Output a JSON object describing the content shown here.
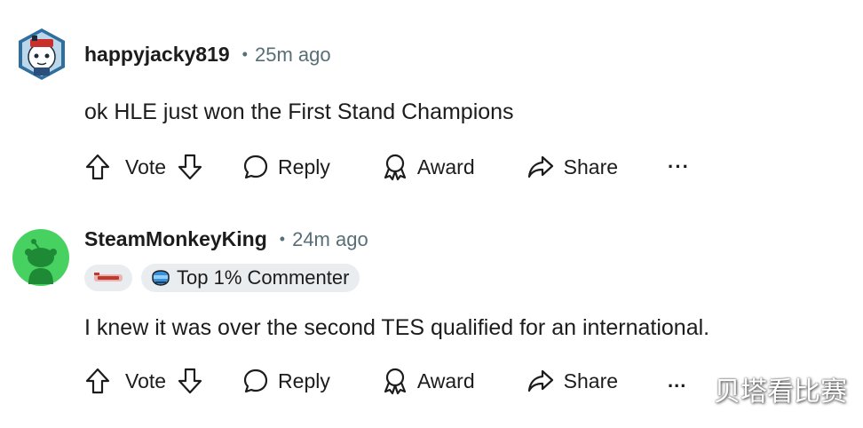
{
  "comments": [
    {
      "username": "happyjacky819",
      "separator": "•",
      "time": "25m ago",
      "text": "ok HLE just won the First Stand Champions",
      "avatar_icon": "snoo-avatar-icon",
      "actions": {
        "vote": "Vote",
        "reply": "Reply",
        "award": "Award",
        "share": "Share",
        "more": "···"
      }
    },
    {
      "username": "SteamMonkeyKing",
      "separator": "•",
      "time": "24m ago",
      "text": "I knew it was over the second TES qualified for an international.",
      "avatar_icon": "default-snoo-avatar-icon",
      "badges": {
        "top_commenter": "Top 1% Commenter"
      },
      "actions": {
        "vote": "Vote",
        "reply": "Reply",
        "award": "Award",
        "share": "Share",
        "more": "..."
      }
    }
  ],
  "watermark": "贝塔看比赛",
  "colors": {
    "text": "#1c1c1c",
    "muted": "#576f76",
    "pill_bg": "#eaedef",
    "default_avatar": "#46d160"
  }
}
